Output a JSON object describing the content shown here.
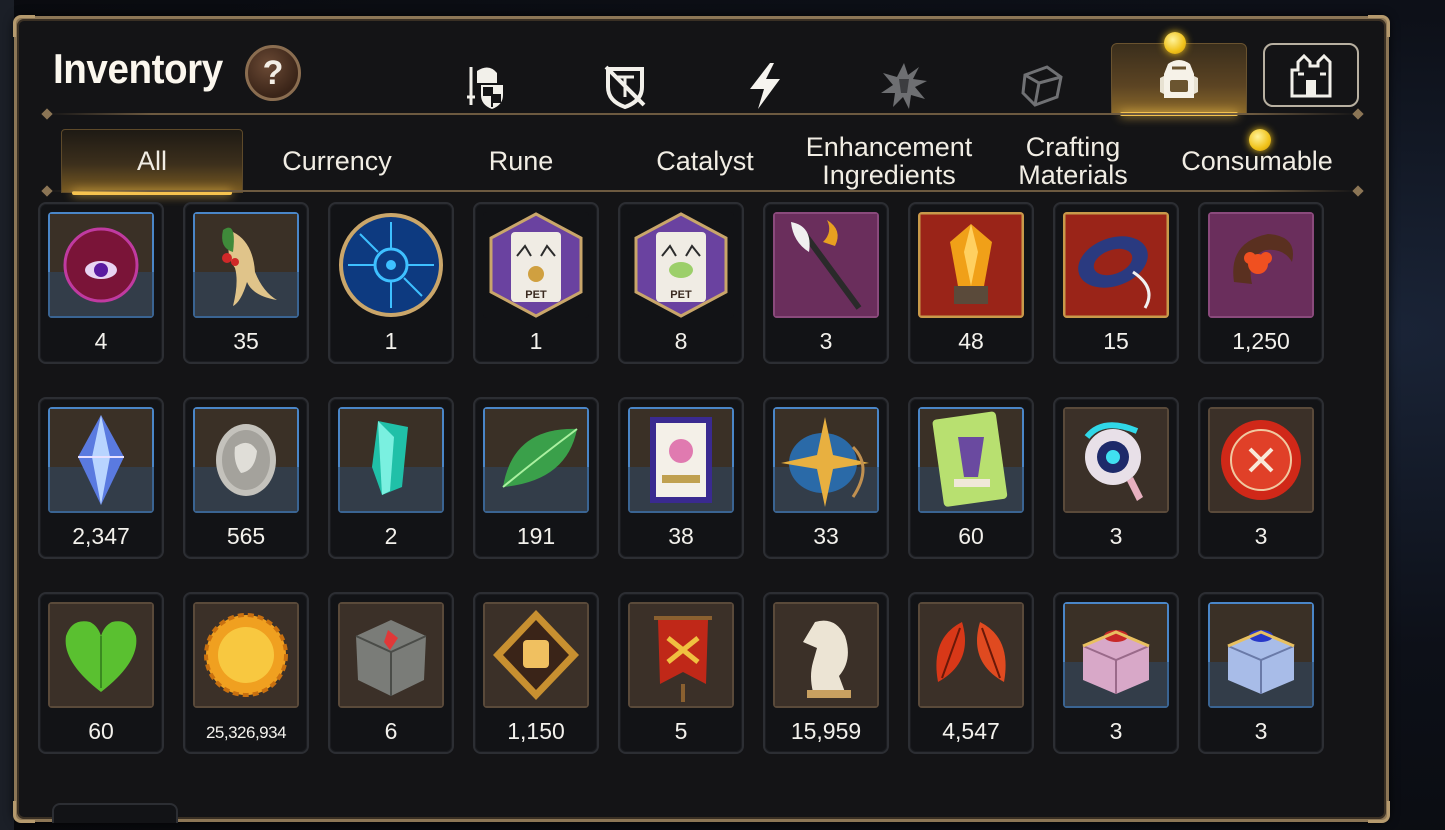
{
  "header": {
    "title": "Inventory",
    "help_label": "?"
  },
  "category_tabs": [
    {
      "icon": "knight-shield-sword-icon",
      "active": false
    },
    {
      "icon": "crossed-shield-icon",
      "active": false
    },
    {
      "icon": "lightning-icon",
      "active": false
    },
    {
      "icon": "splatter-emblem-icon",
      "active": false
    },
    {
      "icon": "cube-icon",
      "active": false
    },
    {
      "icon": "backpack-icon",
      "active": true,
      "notification": true
    }
  ],
  "castle_button": {
    "icon": "castle-icon"
  },
  "subtabs": [
    {
      "label": "All",
      "active": true
    },
    {
      "label": "Currency",
      "active": false
    },
    {
      "label": "Rune",
      "active": false
    },
    {
      "label": "Catalyst",
      "active": false
    },
    {
      "label": "Enhancement Ingredients",
      "active": false
    },
    {
      "label": "Crafting Materials",
      "active": false
    },
    {
      "label": "Consumable",
      "active": false,
      "notification": true
    }
  ],
  "items": [
    {
      "icon": "purple-eye-orb-icon",
      "quantity": "4",
      "frame": "blue"
    },
    {
      "icon": "ginseng-root-icon",
      "quantity": "35",
      "frame": "blue"
    },
    {
      "icon": "blue-circuit-rune-icon",
      "quantity": "1",
      "frame": "round"
    },
    {
      "icon": "pet-food-bag-gold-icon",
      "quantity": "1",
      "frame": "hex"
    },
    {
      "icon": "pet-food-bag-icon",
      "quantity": "8",
      "frame": "hex"
    },
    {
      "icon": "feather-wand-icon",
      "quantity": "3",
      "frame": "purple"
    },
    {
      "icon": "amber-crystal-icon",
      "quantity": "48",
      "frame": "red"
    },
    {
      "icon": "blue-belt-icon",
      "quantity": "15",
      "frame": "red"
    },
    {
      "icon": "flower-ring-icon",
      "quantity": "1,250",
      "frame": "purple"
    },
    {
      "icon": "blue-gem-icon",
      "quantity": "2,347",
      "frame": "blue"
    },
    {
      "icon": "silver-coin-icon",
      "quantity": "565",
      "frame": "blue"
    },
    {
      "icon": "teal-crystal-icon",
      "quantity": "2",
      "frame": "blue"
    },
    {
      "icon": "green-leaf-icon",
      "quantity": "191",
      "frame": "blue"
    },
    {
      "icon": "pet-card-icon",
      "quantity": "38",
      "frame": "blue"
    },
    {
      "icon": "star-compass-icon",
      "quantity": "33",
      "frame": "blue"
    },
    {
      "icon": "costume-card-icon",
      "quantity": "60",
      "frame": "blue"
    },
    {
      "icon": "cyan-orb-device-icon",
      "quantity": "3",
      "frame": "brown"
    },
    {
      "icon": "red-seal-badge-icon",
      "quantity": "3",
      "frame": "brown"
    },
    {
      "icon": "green-heart-icon",
      "quantity": "60",
      "frame": "brown"
    },
    {
      "icon": "gold-sun-coin-icon",
      "quantity": "25,326,934",
      "frame": "brown"
    },
    {
      "icon": "stone-block-icon",
      "quantity": "6",
      "frame": "brown"
    },
    {
      "icon": "fist-emblem-icon",
      "quantity": "1,150",
      "frame": "brown"
    },
    {
      "icon": "war-banner-icon",
      "quantity": "5",
      "frame": "brown"
    },
    {
      "icon": "white-knight-icon",
      "quantity": "15,959",
      "frame": "brown"
    },
    {
      "icon": "red-leaves-icon",
      "quantity": "4,547",
      "frame": "brown"
    },
    {
      "icon": "pink-chest-icon",
      "quantity": "3",
      "frame": "blue"
    },
    {
      "icon": "blue-chest-icon",
      "quantity": "3",
      "frame": "blue"
    }
  ],
  "colors": {
    "accent_gold": "#f3c24d",
    "frame_border": "#8c7656",
    "panel_bg": "#141416"
  }
}
